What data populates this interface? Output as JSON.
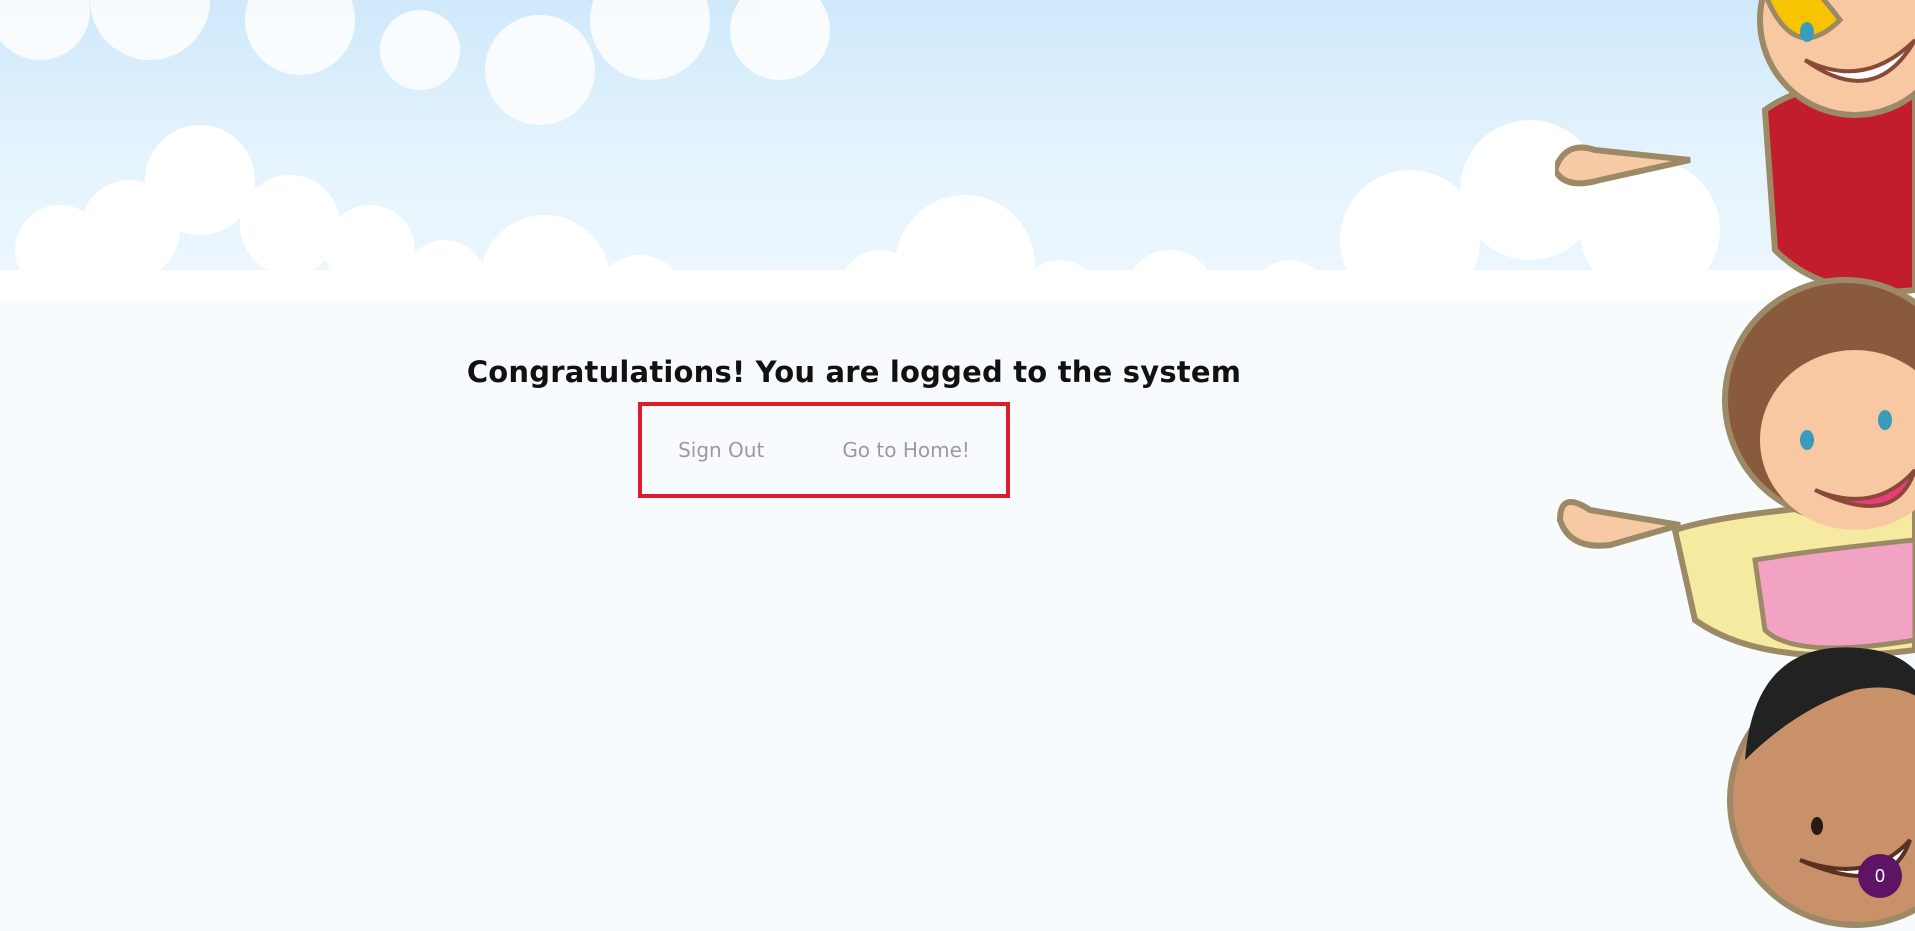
{
  "page": {
    "headline": "Congratulations! You are logged to the system"
  },
  "actions": {
    "sign_out_label": "Sign Out",
    "go_home_label": "Go to Home!",
    "highlight_color": "#e01b2a"
  },
  "badge": {
    "count": "0",
    "color": "#5d1464"
  },
  "background": {
    "illustration": "waving-kids-illustration",
    "sky_color": "#cfe9fb"
  }
}
